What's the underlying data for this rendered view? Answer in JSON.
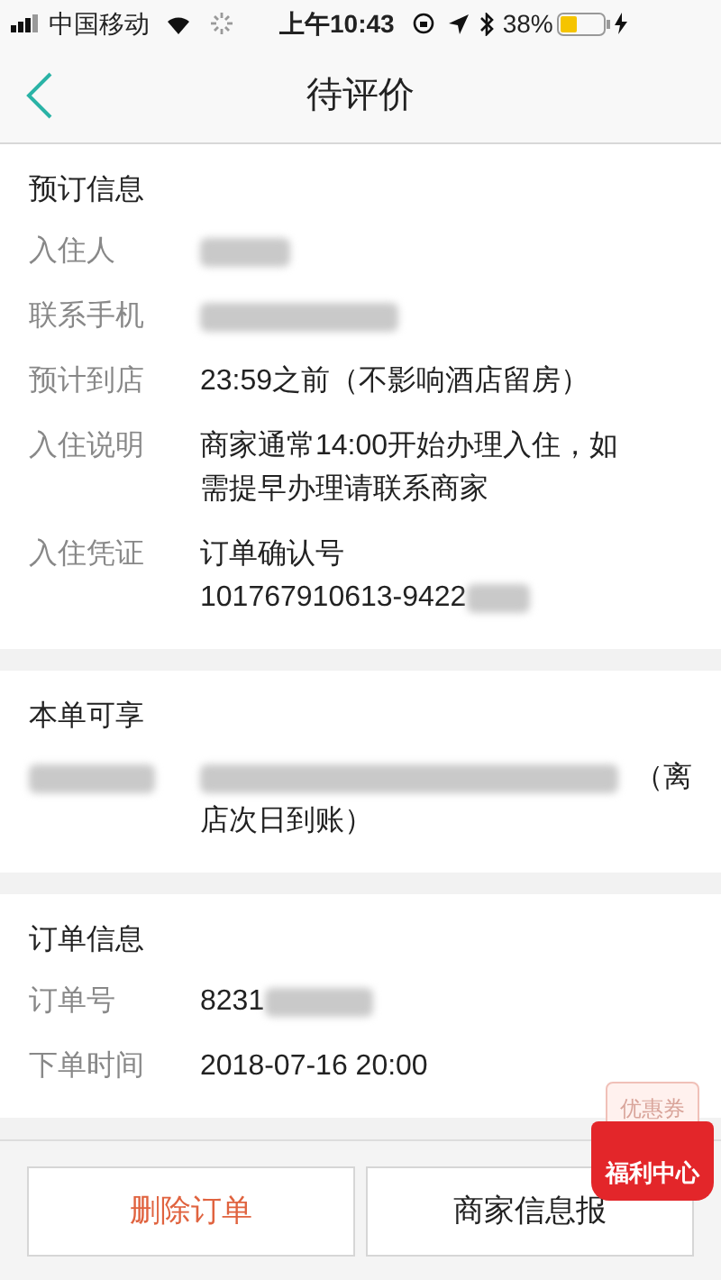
{
  "status_bar": {
    "carrier": "中国移动",
    "time": "上午10:43",
    "battery": "38%"
  },
  "nav": {
    "title": "待评价"
  },
  "sections": [
    {
      "title": "预订信息",
      "rows": [
        {
          "label": "入住人",
          "lines": [
            {
              "kind": "blur"
            }
          ]
        },
        {
          "label": "联系手机",
          "lines": [
            {
              "kind": "blur"
            }
          ]
        },
        {
          "label": "预计到店",
          "lines": [
            {
              "kind": "text",
              "text": "23:59之前（不影响酒店留房）"
            }
          ]
        },
        {
          "label": "入住说明",
          "lines": [
            {
              "kind": "text",
              "text": "商家通常14:00开始办理入住，如"
            },
            {
              "kind": "text",
              "text": "需提早办理请联系商家"
            }
          ]
        },
        {
          "label": "入住凭证",
          "lines": [
            {
              "kind": "text",
              "text": "订单确认号"
            },
            {
              "kind": "text_then_blur",
              "text": "101767910613-9422"
            }
          ]
        }
      ]
    },
    {
      "title": "本单可享",
      "rows": [
        {
          "lines": [
            {
              "kind": "blur_then_text",
              "text": "（离"
            },
            {
              "kind": "text",
              "text": "店次日到账）"
            }
          ]
        }
      ]
    },
    {
      "title": "订单信息",
      "rows": [
        {
          "label": "订单号",
          "lines": [
            {
              "kind": "text_then_blur",
              "text": "8231"
            }
          ]
        },
        {
          "label": "下单时间",
          "lines": [
            {
              "kind": "text",
              "text": "2018-07-16 20:00"
            }
          ]
        }
      ]
    }
  ],
  "buttons": [
    {
      "label": "删除订单",
      "kind": "danger"
    },
    {
      "label": "商家信息报",
      "kind": "normal"
    }
  ],
  "promo": {
    "coupon": "优惠券",
    "label": "福利中心"
  }
}
